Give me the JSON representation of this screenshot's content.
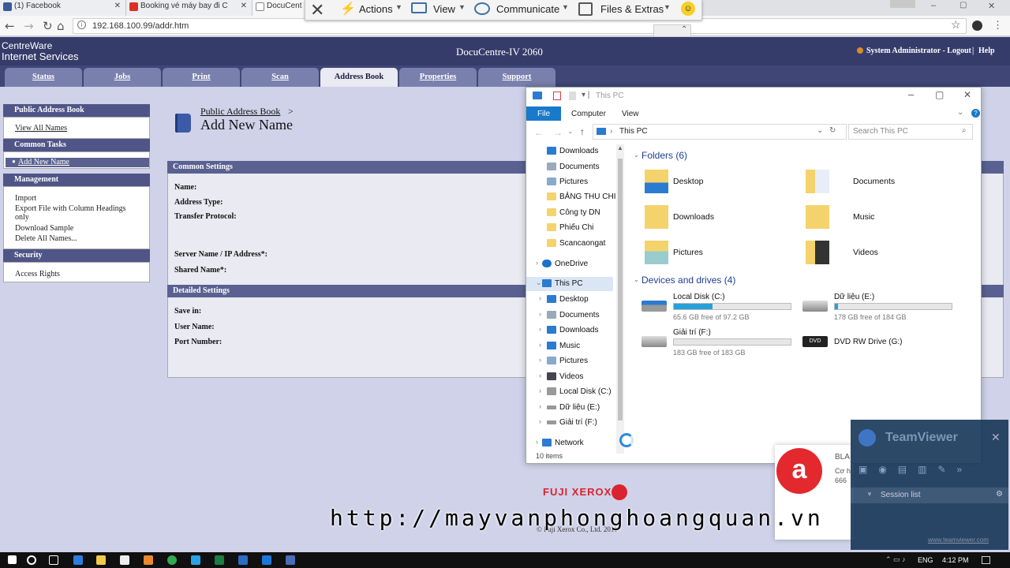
{
  "browser": {
    "tabs": [
      {
        "label": "(1) Facebook",
        "color": "#3b5998"
      },
      {
        "label": "Booking vé máy bay đi C",
        "color": "#d93025"
      },
      {
        "label": "DocuCent",
        "color": "#888888"
      }
    ],
    "url": "192.168.100.99/addr.htm"
  },
  "teamviewer_bar": {
    "actions": "Actions",
    "view": "View",
    "communicate": "Communicate",
    "files": "Files & Extras"
  },
  "header": {
    "brand_line1": "CentreWare",
    "brand_line2": "Internet Services",
    "device": "DocuCentre-IV 2060",
    "user": "System Administrator - Logout",
    "help": "Help"
  },
  "nav_tabs": [
    "Status",
    "Jobs",
    "Print",
    "Scan",
    "Address Book",
    "Properties",
    "Support"
  ],
  "sidebar": {
    "public_address_book": "Public Address Book",
    "view_all_names": "View All Names",
    "common_tasks": "Common Tasks",
    "add_new_name": "Add New Name",
    "management": "Management",
    "import": "Import",
    "export": "Export File with Column Headings only",
    "download_sample": "Download Sample",
    "delete_all": "Delete All Names...",
    "security": "Security",
    "access_rights": "Access Rights"
  },
  "main": {
    "breadcrumb": "Public Address Book",
    "breadcrumb_sep": ">",
    "title": "Add New Name",
    "common_settings": "Common Settings",
    "name": "Name:",
    "address_type": "Address Type:",
    "transfer_protocol": "Transfer Protocol:",
    "server_name": "Server Name / IP Address*:",
    "shared_name": "Shared Name*:",
    "detailed_settings": "Detailed Settings",
    "save_in": "Save in:",
    "user_name": "User Name:",
    "port_number": "Port Number:",
    "footer_logo": "FUJI XEROX",
    "footer_copyright": "© Fuji Xerox Co., Ltd. 2011"
  },
  "explorer": {
    "title": "This PC",
    "ribbon_tabs": [
      "File",
      "Computer",
      "View"
    ],
    "path": "This PC",
    "search_placeholder": "Search This PC",
    "nav_items": [
      {
        "label": "Downloads",
        "icon": "download-icon"
      },
      {
        "label": "Documents",
        "icon": "documents-icon"
      },
      {
        "label": "Pictures",
        "icon": "pictures-icon"
      },
      {
        "label": "BẢNG THU CHI",
        "icon": "folder-icon"
      },
      {
        "label": "Công ty DN",
        "icon": "folder-icon"
      },
      {
        "label": "Phiếu Chi",
        "icon": "folder-icon"
      },
      {
        "label": "Scancaongat",
        "icon": "folder-icon"
      }
    ],
    "onedrive": "OneDrive",
    "thispc": "This PC",
    "pc_items": [
      {
        "label": "Desktop"
      },
      {
        "label": "Documents"
      },
      {
        "label": "Downloads"
      },
      {
        "label": "Music"
      },
      {
        "label": "Pictures"
      },
      {
        "label": "Videos"
      },
      {
        "label": "Local Disk (C:)"
      },
      {
        "label": "Dữ liệu (E:)"
      },
      {
        "label": "Giải trí (F:)"
      }
    ],
    "network": "Network",
    "status": "10 items",
    "folders_heading": "Folders (6)",
    "folders": [
      "Desktop",
      "Documents",
      "Downloads",
      "Music",
      "Pictures",
      "Videos"
    ],
    "drives_heading": "Devices and drives (4)",
    "drives": [
      {
        "name": "Local Disk (C:)",
        "free": "65.6 GB free of 97.2 GB",
        "used_fraction": 0.33
      },
      {
        "name": "Dữ liệu (E:)",
        "free": "178 GB free of 184 GB",
        "used_fraction": 0.03
      },
      {
        "name": "Giải trí (F:)",
        "free": "183 GB free of 183 GB",
        "used_fraction": 0.0
      },
      {
        "name": "DVD RW Drive (G:)",
        "free": "",
        "used_fraction": null
      }
    ]
  },
  "teamviewer_panel": {
    "title": "TeamViewer",
    "session_list": "Session list",
    "link": "www.teamviewer.com"
  },
  "notification": {
    "app_letter": "a",
    "line1": "BLA",
    "line2": "Cơ h",
    "line3": "666"
  },
  "watermark": "http://mayvanphonghoangquan.vn",
  "taskbar": {
    "lang": "ENG",
    "time": "4:12 PM"
  }
}
